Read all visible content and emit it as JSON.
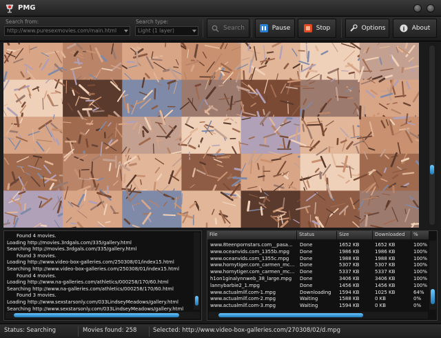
{
  "window": {
    "title": "PMG"
  },
  "toolbar": {
    "search_from_label": "Search from:",
    "search_from_value": "http://www.puresexmovies.com/main.html",
    "search_type_label": "Search type:",
    "search_type_value": "Light (1 layer)",
    "search_button": "Search",
    "pause_button": "Pause",
    "stop_button": "Stop",
    "options_button": "Options",
    "about_button": "About"
  },
  "log": {
    "lines": [
      "Found 4 movies.",
      "Loading http://movies.3rdgals.com/335/gallery.html",
      "Searching http://movies.3rdgals.com/335/gallery.html",
      "Found 3 movies.",
      "Loading http://www.video-box-galleries.com/250308/01/index15.html",
      "Searching http://www.video-box-galleries.com/250308/01/index15.html",
      "Found 4 movies.",
      "Loading http://www.na-galleries.com/athletics/000258/170/60.html",
      "Searching http://www.na-galleries.com/athletics/000258/170/60.html",
      "Found 3 movies.",
      "Loading http://www.sexstarsonly.com/033LindseyMeadows/gallery.html",
      "Searching http://www.sexstarsonly.com/033LindseyMeadows/gallery.html"
    ]
  },
  "downloads": {
    "columns": [
      "File",
      "Status",
      "Size",
      "Downloaded",
      "%"
    ],
    "rows": [
      [
        "www.8teenpornstars.com__pasa...",
        "Done",
        "1652 KB",
        "1652 KB",
        "100%"
      ],
      [
        "www.oceanvids.com_1355b.mpg",
        "Done",
        "1986 KB",
        "1986 KB",
        "100%"
      ],
      [
        "www.oceanvids.com_1355c.mpg",
        "Done",
        "1988 KB",
        "1988 KB",
        "100%"
      ],
      [
        "www.hornytiger.com_carmen_mc...",
        "Done",
        "5307 KB",
        "5307 KB",
        "100%"
      ],
      [
        "www.hornytiger.com_carmen_mc...",
        "Done",
        "5337 KB",
        "5337 KB",
        "100%"
      ],
      [
        "h1on1ginalynnweb_38_large.mpg",
        "Done",
        "3406 KB",
        "3406 KB",
        "100%"
      ],
      [
        "lannybarbie2_1.mpg",
        "Done",
        "1456 KB",
        "1456 KB",
        "100%"
      ],
      [
        "www.actualmilf.com-1.mpg",
        "Downloading",
        "1594 KB",
        "1025 KB",
        "64%"
      ],
      [
        "www.actualmilf.com-2.mpg",
        "Waiting",
        "1588 KB",
        "0 KB",
        "0%"
      ],
      [
        "www.actualmilf.com-3.mpg",
        "Waiting",
        "1594 KB",
        "0 KB",
        "0%"
      ]
    ]
  },
  "status": {
    "status_text": "Status: Searching",
    "movies_found": "Movies found: 258",
    "selected": "Selected: http://www.video-box-galleries.com/270308/02/d.mpg"
  },
  "colors": {
    "accent_blue": "#3aa0e8",
    "stop_red": "#e04a22",
    "background": "#1b1b1b"
  }
}
